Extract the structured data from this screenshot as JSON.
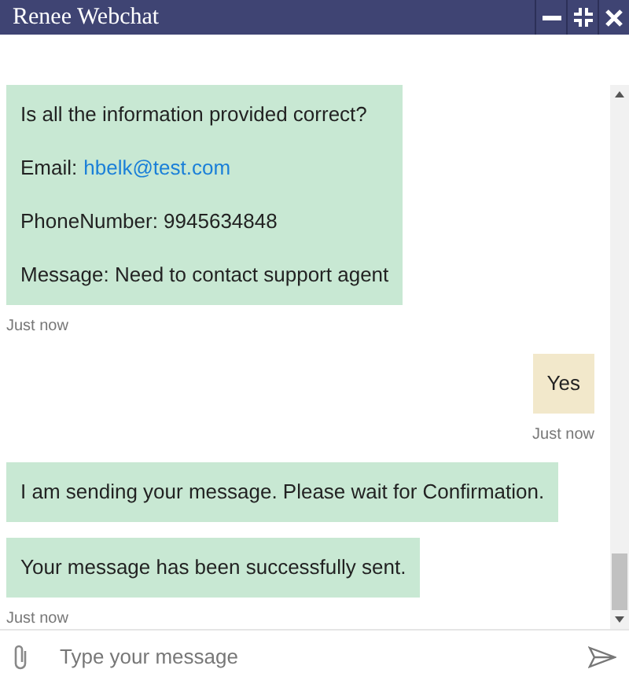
{
  "window": {
    "title": "Renee Webchat"
  },
  "messages": [
    {
      "kind": "bot",
      "paragraphs": [
        {
          "text": "Is all the information provided correct?"
        },
        {
          "text": "Email:",
          "link": "hbelk@test.com"
        },
        {
          "text": "PhoneNumber: 9945634848"
        },
        {
          "text": "Message: Need to contact support agent"
        }
      ],
      "time": "Just now"
    },
    {
      "kind": "user",
      "paragraphs": [
        {
          "text": "Yes"
        }
      ],
      "time": "Just now"
    },
    {
      "kind": "bot",
      "paragraphs": [
        {
          "text": "I am sending your message. Please wait for Confirmation."
        }
      ]
    },
    {
      "kind": "bot",
      "paragraphs": [
        {
          "text": "Your message has been successfully sent."
        }
      ],
      "time": "Just now"
    }
  ],
  "composer": {
    "placeholder": "Type your message"
  }
}
